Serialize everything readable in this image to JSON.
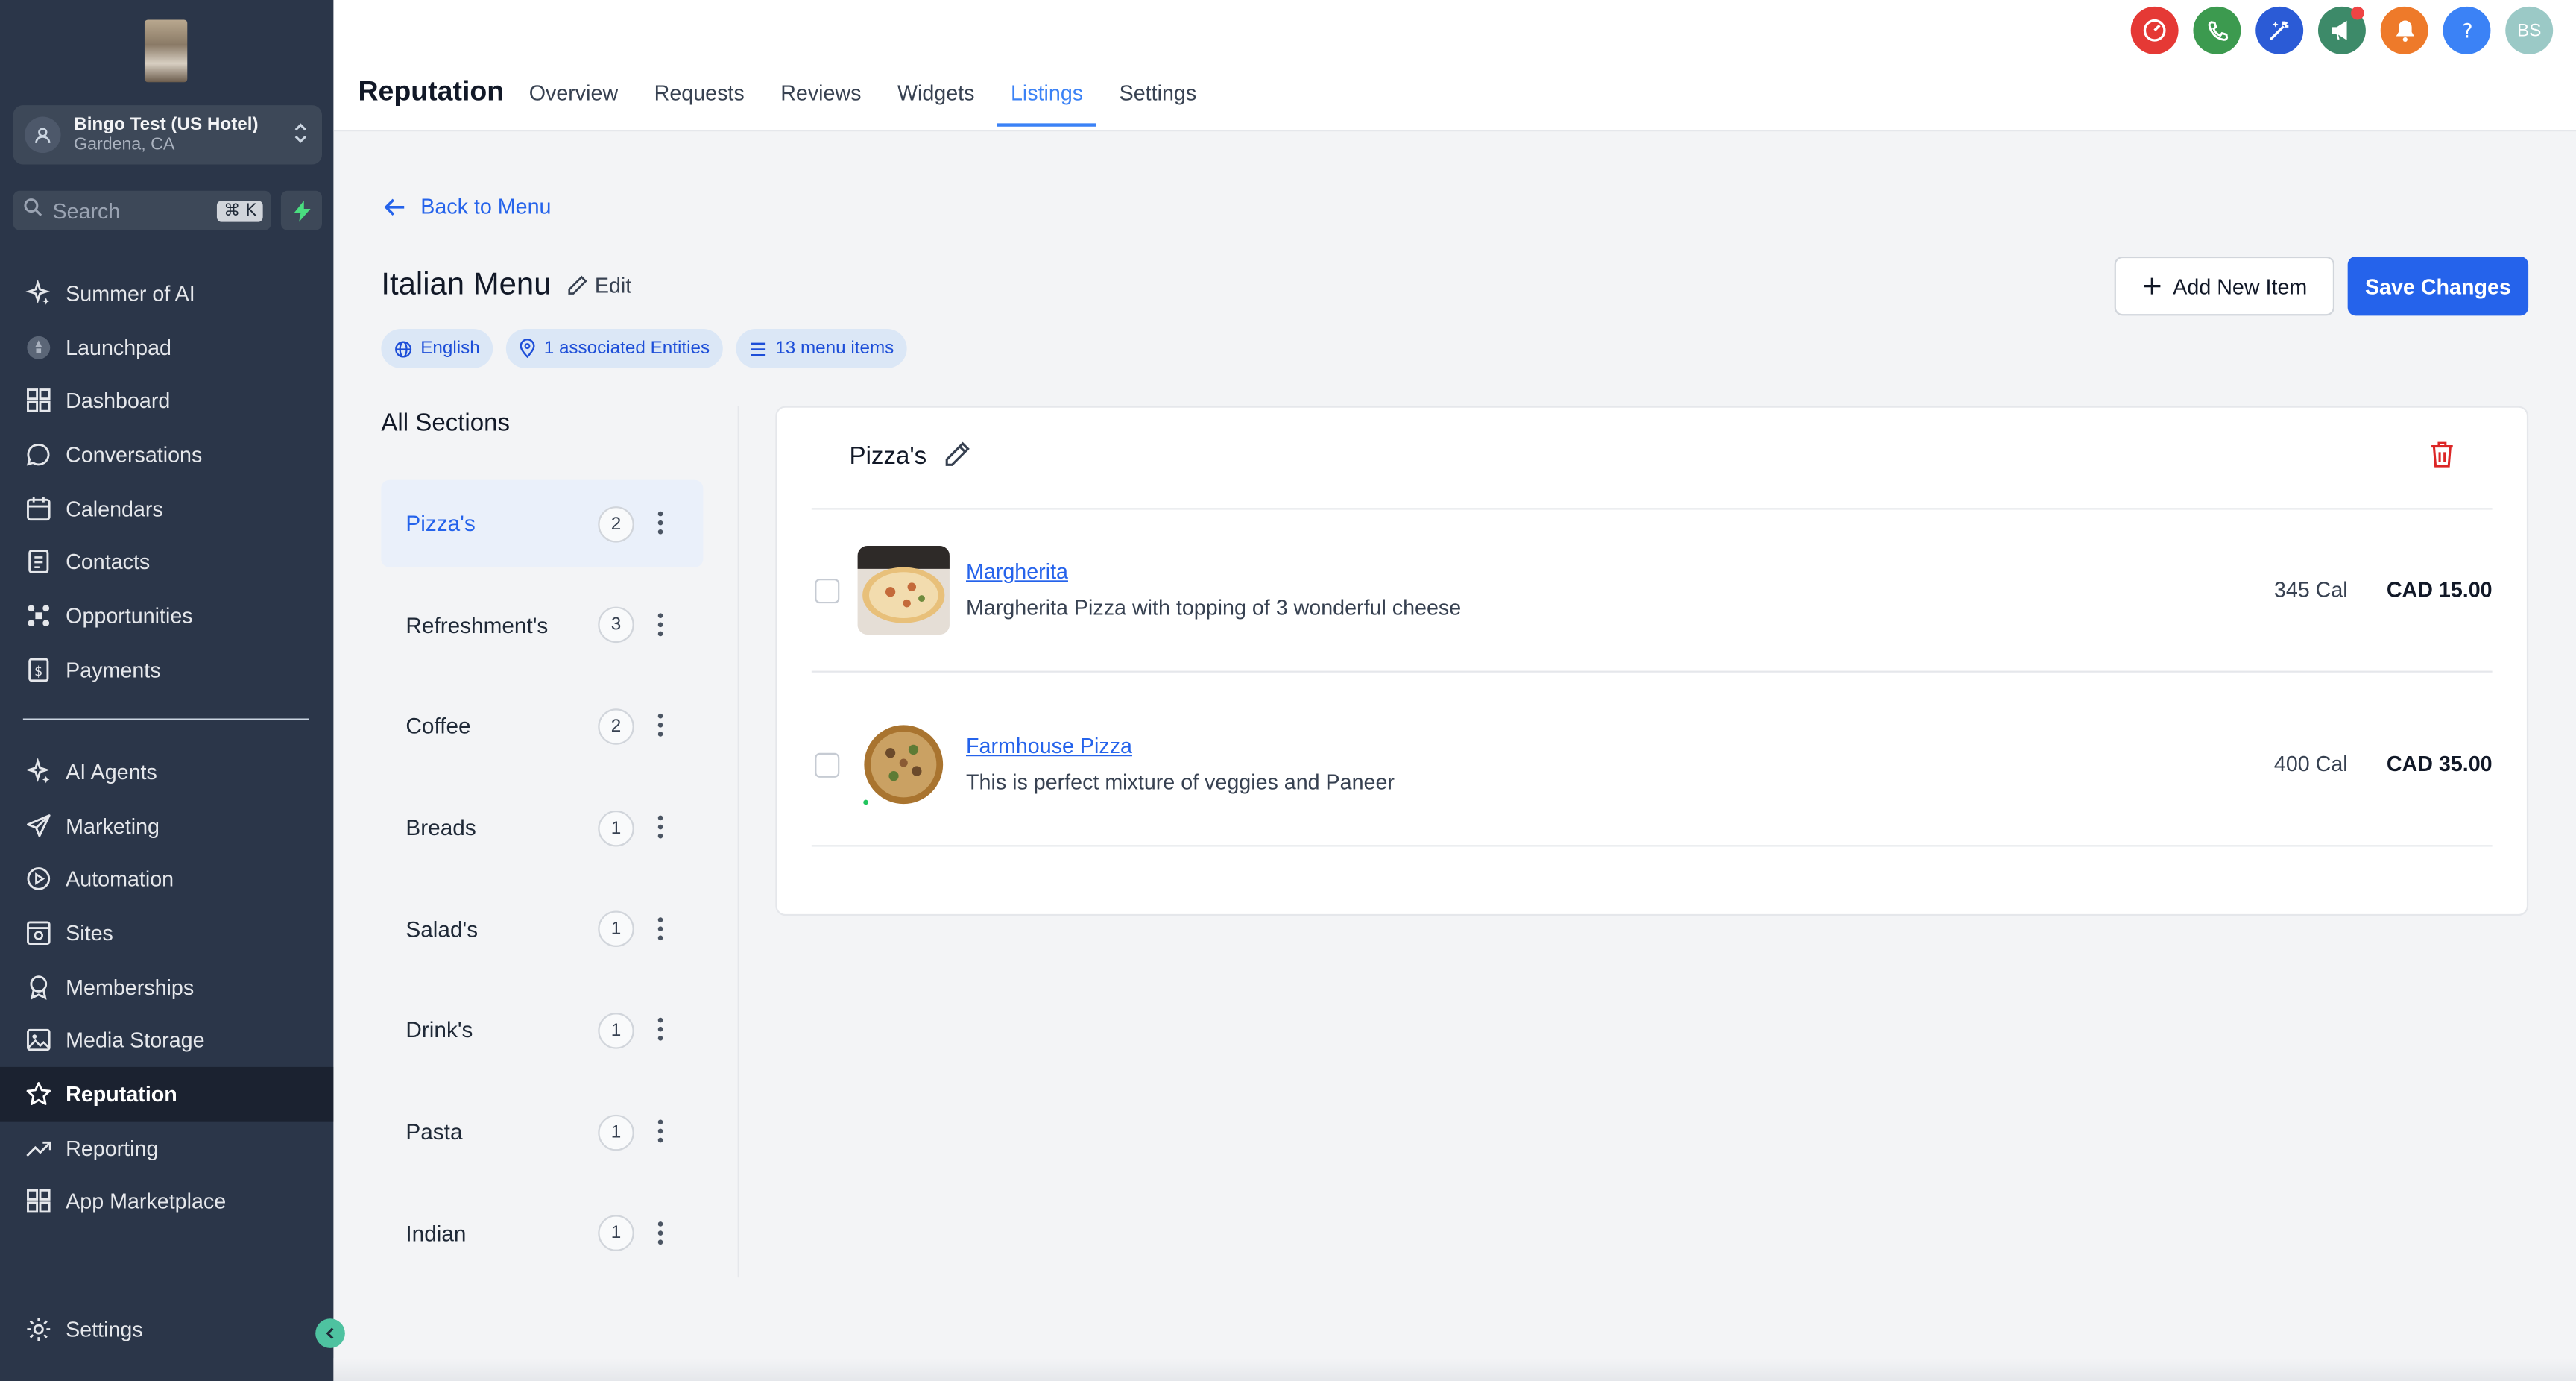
{
  "location": {
    "name": "Bingo Test (US Hotel)",
    "city": "Gardena, CA"
  },
  "search": {
    "placeholder": "Search",
    "shortcut": "⌘ K"
  },
  "sidebar": {
    "items": [
      {
        "label": "Summer of AI",
        "icon": "sparkle-icon"
      },
      {
        "label": "Launchpad",
        "icon": "rocket-icon"
      },
      {
        "label": "Dashboard",
        "icon": "dashboard-icon"
      },
      {
        "label": "Conversations",
        "icon": "chat-icon"
      },
      {
        "label": "Calendars",
        "icon": "calendar-icon"
      },
      {
        "label": "Contacts",
        "icon": "contacts-icon"
      },
      {
        "label": "Opportunities",
        "icon": "opportunities-icon"
      },
      {
        "label": "Payments",
        "icon": "payments-icon"
      }
    ],
    "items2": [
      {
        "label": "AI Agents",
        "icon": "sparkle-icon"
      },
      {
        "label": "Marketing",
        "icon": "send-icon"
      },
      {
        "label": "Automation",
        "icon": "automation-icon"
      },
      {
        "label": "Sites",
        "icon": "sites-icon"
      },
      {
        "label": "Memberships",
        "icon": "badge-icon"
      },
      {
        "label": "Media Storage",
        "icon": "image-icon"
      },
      {
        "label": "Reputation",
        "icon": "star-icon"
      },
      {
        "label": "Reporting",
        "icon": "trend-icon"
      },
      {
        "label": "App Marketplace",
        "icon": "grid-icon"
      }
    ],
    "settings": "Settings"
  },
  "header": {
    "title": "Reputation",
    "tabs": [
      "Overview",
      "Requests",
      "Reviews",
      "Widgets",
      "Listings",
      "Settings"
    ],
    "active_tab": "Listings",
    "avatar_initials": "BS"
  },
  "page": {
    "back_label": "Back to Menu",
    "menu_title": "Italian Menu",
    "edit_label": "Edit",
    "chips": [
      "English",
      "1 associated Entities",
      "13 menu items"
    ],
    "add_item_label": "Add New Item",
    "save_label": "Save Changes",
    "sections_title": "All Sections"
  },
  "sections": [
    {
      "name": "Pizza's",
      "count": "2"
    },
    {
      "name": "Refreshment's",
      "count": "3"
    },
    {
      "name": "Coffee",
      "count": "2"
    },
    {
      "name": "Breads",
      "count": "1"
    },
    {
      "name": "Salad's",
      "count": "1"
    },
    {
      "name": "Drink's",
      "count": "1"
    },
    {
      "name": "Pasta",
      "count": "1"
    },
    {
      "name": "Indian",
      "count": "1"
    }
  ],
  "panel": {
    "title": "Pizza's",
    "items": [
      {
        "name": "Margherita",
        "description": "Margherita Pizza with topping of 3 wonderful cheese",
        "calories": "345 Cal",
        "price": "CAD 15.00"
      },
      {
        "name": "Farmhouse Pizza",
        "description": "This is perfect mixture of veggies and Paneer",
        "calories": "400 Cal",
        "price": "CAD 35.00"
      }
    ]
  },
  "colors": {
    "sidebar": "#2b3649",
    "accent": "#2563eb",
    "danger": "#dc2626"
  }
}
